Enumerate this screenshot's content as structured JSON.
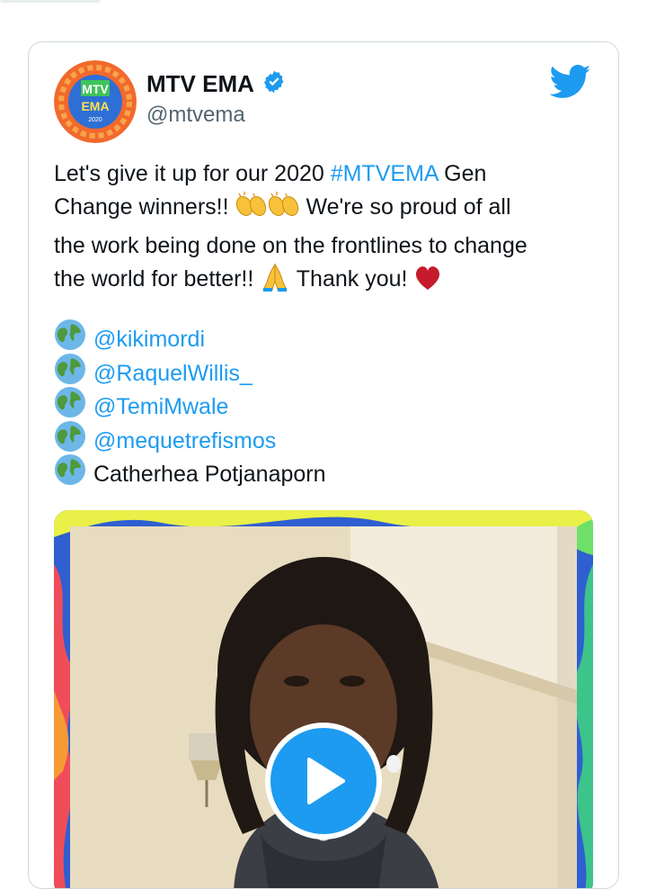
{
  "tweet": {
    "author_name": "MTV EMA",
    "handle": "@mtvema",
    "avatar_logo_text": "MTV",
    "avatar_logo_sub": "EMA",
    "avatar_year": "2020",
    "text_line1_a": "Let's give it up for our 2020 ",
    "hashtag": "#MTVEMA",
    "text_line1_b": " Gen",
    "text_line2_a": "Change winners!! ",
    "text_line2_b": " We're so proud of all",
    "text_line3": "the work being done on the frontlines to change",
    "text_line4_a": "the world for better!! ",
    "text_line4_b": " Thank you! ",
    "mentions": [
      "@kikimordi",
      "@RaquelWillis_",
      "@TemiMwale",
      "@mequetrefismos"
    ],
    "plain_name": "Catherhea Potjanaporn"
  },
  "colors": {
    "accent": "#1d9bf0",
    "text": "#0f1419",
    "muted": "#536471",
    "heart": "#c51b2d"
  },
  "icons": [
    "verified-badge-icon",
    "twitter-bird-icon",
    "clapping-hands-icon",
    "folded-hands-icon",
    "red-heart-icon",
    "globe-icon",
    "play-icon"
  ]
}
